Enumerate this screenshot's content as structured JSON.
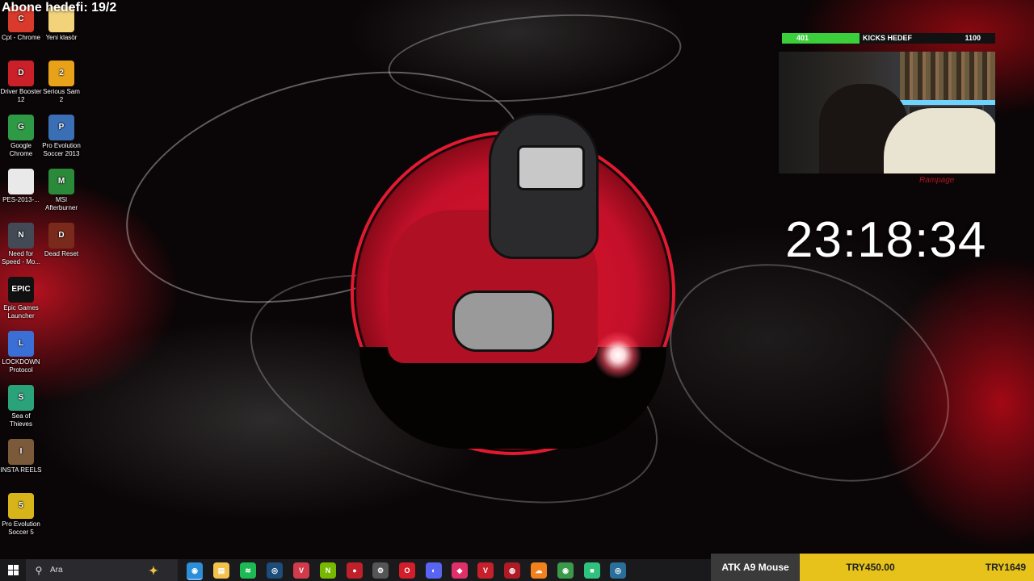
{
  "overlay": {
    "subscriber_goal": "Abone hedefi: 19/2"
  },
  "desktop_icons": [
    {
      "label": "Cpt - Chrome",
      "glyph": "C",
      "color": "#d93a2b",
      "icon": "chrome-app-icon"
    },
    {
      "label": "Yeni klasör",
      "glyph": "",
      "color": "#f2d37a",
      "icon": "folder-icon"
    },
    {
      "label": "Driver Booster 12",
      "glyph": "D",
      "color": "#c9202a",
      "icon": "driver-booster-icon"
    },
    {
      "label": "Serious Sam 2",
      "glyph": "2",
      "color": "#e8a21a",
      "icon": "serious-sam-icon"
    },
    {
      "label": "Google Chrome",
      "glyph": "G",
      "color": "#2f9a45",
      "icon": "google-chrome-icon"
    },
    {
      "label": "Pro Evolution Soccer 2013",
      "glyph": "P",
      "color": "#3a6fb6",
      "icon": "pes-2013-icon"
    },
    {
      "label": "PES-2013-...",
      "glyph": "",
      "color": "#e9e9e9",
      "icon": "file-icon"
    },
    {
      "label": "MSI Afterburner",
      "glyph": "M",
      "color": "#2a8a3a",
      "icon": "msi-afterburner-icon"
    },
    {
      "label": "Need for Speed - Mo...",
      "glyph": "N",
      "color": "#444a55",
      "icon": "need-for-speed-icon"
    },
    {
      "label": "Dead Reset",
      "glyph": "D",
      "color": "#7a2a1a",
      "icon": "dead-reset-icon"
    },
    {
      "label": "Epic Games Launcher",
      "glyph": "EPIC",
      "color": "#111111",
      "icon": "epic-games-icon"
    },
    {
      "label": "LOCKDOWN Protocol",
      "glyph": "L",
      "color": "#3a6fd6",
      "icon": "lockdown-protocol-icon"
    },
    {
      "label": "Sea of Thieves",
      "glyph": "S",
      "color": "#2aa27a",
      "icon": "sea-of-thieves-icon"
    },
    {
      "label": "INSTA REELS",
      "glyph": "I",
      "color": "#7a5a3a",
      "icon": "insta-reels-icon"
    },
    {
      "label": "Pro Evolution Soccer 5",
      "glyph": "5",
      "color": "#d6b41a",
      "icon": "pes-5-icon"
    }
  ],
  "kicks": {
    "current": "401",
    "label": "KICKS HEDEF",
    "goal": "1100",
    "progress": 0.365,
    "fill_color": "#3ccf3c"
  },
  "webcam": {
    "brand": "Rampage"
  },
  "clock": "23:18:34",
  "taskbar": {
    "search_placeholder": "Ara",
    "apps": [
      {
        "icon": "copilot-icon",
        "glyph": "✦",
        "color": "#f0c33c"
      },
      {
        "icon": "browser-icon",
        "glyph": "◉",
        "color": "#2a8fd8"
      },
      {
        "icon": "file-explorer-icon",
        "glyph": "▤",
        "color": "#f2c14e"
      },
      {
        "icon": "spotify-icon",
        "glyph": "≋",
        "color": "#1db954"
      },
      {
        "icon": "steam-icon",
        "glyph": "◎",
        "color": "#1b4c7a"
      },
      {
        "icon": "valorant-icon",
        "glyph": "V",
        "color": "#d13b4b"
      },
      {
        "icon": "nvidia-icon",
        "glyph": "N",
        "color": "#76b900"
      },
      {
        "icon": "game-icon-red",
        "glyph": "●",
        "color": "#c0202a"
      },
      {
        "icon": "gpu-tool-icon",
        "glyph": "⚙",
        "color": "#555555"
      },
      {
        "icon": "opera-icon",
        "glyph": "O",
        "color": "#d21d2b"
      },
      {
        "icon": "discord-icon",
        "glyph": "◐",
        "color": "#5865f2"
      },
      {
        "icon": "map-pin-icon",
        "glyph": "◆",
        "color": "#e0306a"
      },
      {
        "icon": "voice-mod-icon",
        "glyph": "V",
        "color": "#c8202a"
      },
      {
        "icon": "recorder-icon",
        "glyph": "◍",
        "color": "#b01a24"
      },
      {
        "icon": "cloud-icon",
        "glyph": "☁",
        "color": "#f2801c"
      },
      {
        "icon": "chrome-icon",
        "glyph": "◉",
        "color": "#3a9a4a"
      },
      {
        "icon": "chat-app-icon",
        "glyph": "■",
        "color": "#2ec27e"
      },
      {
        "icon": "steam-alt-icon",
        "glyph": "◎",
        "color": "#2a6f9a"
      }
    ]
  },
  "promo": {
    "product": "ATK A9 Mouse",
    "price": "TRY450.00",
    "price2": "TRY1649"
  }
}
